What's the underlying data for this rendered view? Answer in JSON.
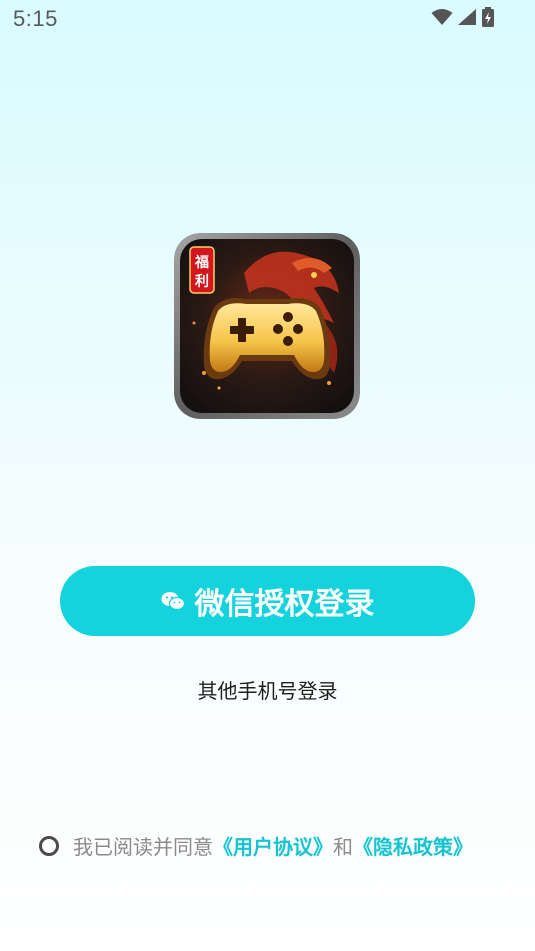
{
  "status_bar": {
    "time": "5:15",
    "icons": [
      "wifi-icon",
      "signal-icon",
      "battery-charging-icon"
    ]
  },
  "app_icon": {
    "badge_text": "福利",
    "icon": "gamepad-dragon-icon"
  },
  "wechat_button": {
    "label": "微信授权登录",
    "icon": "wechat-icon"
  },
  "phone_login": {
    "label": "其他手机号登录"
  },
  "agreement": {
    "prefix": "我已阅读并同意",
    "user_agreement": "《用户协议》",
    "conjunction": "和",
    "privacy_policy": "《隐私政策》"
  },
  "colors": {
    "accent": "#14d3dd",
    "link": "#15c4d0"
  }
}
